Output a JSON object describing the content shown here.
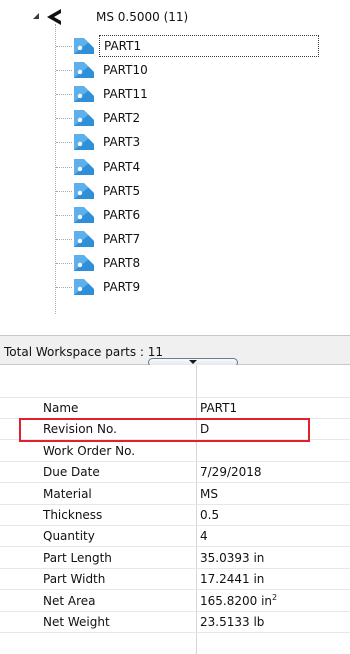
{
  "tree": {
    "root": {
      "label": "MS 0.5000 (11)"
    },
    "items": [
      {
        "label": "PART1",
        "selected": true
      },
      {
        "label": "PART10"
      },
      {
        "label": "PART11"
      },
      {
        "label": "PART2"
      },
      {
        "label": "PART3"
      },
      {
        "label": "PART4"
      },
      {
        "label": "PART5"
      },
      {
        "label": "PART6"
      },
      {
        "label": "PART7"
      },
      {
        "label": "PART8"
      },
      {
        "label": "PART9"
      }
    ]
  },
  "status": {
    "text": "Total Workspace parts : 11"
  },
  "properties": {
    "rows": [
      {
        "name": "Name",
        "value": "PART1"
      },
      {
        "name": "Revision No.",
        "value": "D"
      },
      {
        "name": "Work Order No.",
        "value": ""
      },
      {
        "name": "Due Date",
        "value": "7/29/2018"
      },
      {
        "name": "Material",
        "value": "MS"
      },
      {
        "name": "Thickness",
        "value": "0.5"
      },
      {
        "name": "Quantity",
        "value": "4"
      },
      {
        "name": "Part Length",
        "value": "35.0393 in"
      },
      {
        "name": "Part Width",
        "value": "17.2441 in"
      },
      {
        "name": "Net Area",
        "value": "165.8200 in",
        "sup": "2"
      },
      {
        "name": "Net Weight",
        "value": "23.5133 lb"
      }
    ]
  },
  "colors": {
    "highlight": "#e0202a",
    "part_icon": "#2f8fd8",
    "group_icon": "#111111"
  },
  "icons": {
    "group": "chevron-group-icon",
    "part": "sheet-part-icon",
    "expander": "expand-triangle-icon"
  }
}
